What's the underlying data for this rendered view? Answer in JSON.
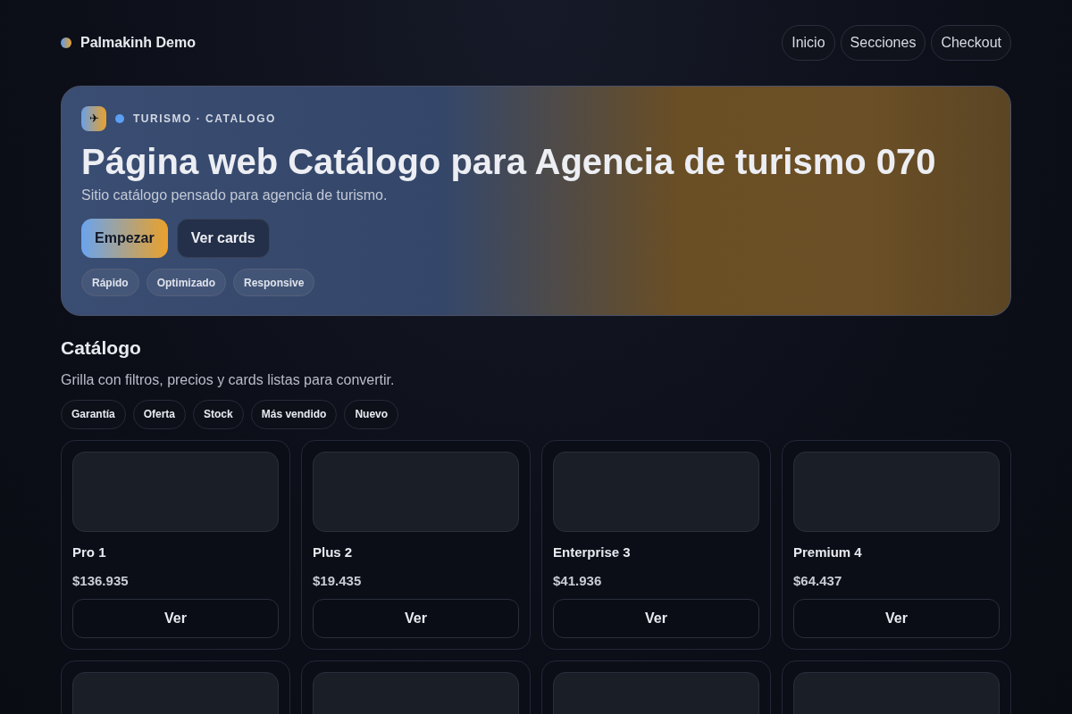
{
  "brand": {
    "name": "Palmakinh Demo"
  },
  "nav": [
    {
      "label": "Inicio"
    },
    {
      "label": "Secciones"
    },
    {
      "label": "Checkout"
    }
  ],
  "hero": {
    "icon": "✈",
    "eyebrow": "TURISMO · CATALOGO",
    "title": "Página web Catálogo para Agencia de turismo 070",
    "subtitle": "Sitio catálogo pensado para agencia de turismo.",
    "buttons": [
      {
        "label": "Empezar",
        "kind": "primary"
      },
      {
        "label": "Ver cards",
        "kind": "secondary"
      }
    ],
    "tags": [
      "Rápido",
      "Optimizado",
      "Responsive"
    ]
  },
  "catalog": {
    "title": "Catálogo",
    "subtitle": "Grilla con filtros, precios y cards listas para convertir.",
    "filters": [
      "Garantía",
      "Oferta",
      "Stock",
      "Más vendido",
      "Nuevo"
    ],
    "products": [
      {
        "kind": "full",
        "name": "Pro 1",
        "price": "$136.935",
        "button": "Ver"
      },
      {
        "kind": "full",
        "name": "Plus 2",
        "price": "$19.435",
        "button": "Ver"
      },
      {
        "kind": "full",
        "name": "Enterprise 3",
        "price": "$41.936",
        "button": "Ver"
      },
      {
        "kind": "full",
        "name": "Premium 4",
        "price": "$64.437",
        "button": "Ver"
      },
      {
        "kind": "cut"
      },
      {
        "kind": "cut"
      },
      {
        "kind": "cut"
      },
      {
        "kind": "cut"
      }
    ]
  }
}
